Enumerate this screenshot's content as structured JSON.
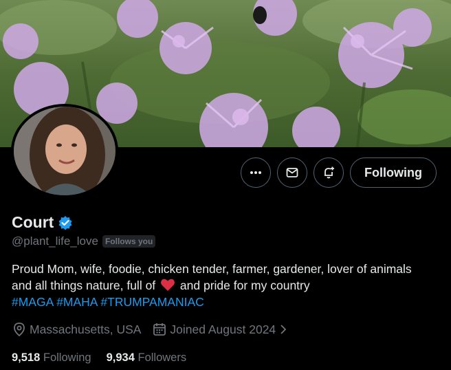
{
  "profile": {
    "name": "Court",
    "handle": "@plant_life_love",
    "follows_you": "Follows you",
    "bio_line": "Proud Mom, wife, foodie, chicken tender, farmer, gardener, lover of animals and all things nature, full of",
    "bio_tail": "and pride for my country",
    "hashtags": [
      "#MAGA",
      "#MAHA",
      "#TRUMPAMANIAC"
    ],
    "location": "Massachusetts, USA",
    "joined": "Joined August 2024",
    "following_count": "9,518",
    "following_label": "Following",
    "followers_count": "9,934",
    "followers_label": "Followers"
  },
  "actions": {
    "follow_label": "Following",
    "icons": [
      "more-icon",
      "message-icon",
      "notification-icon"
    ]
  },
  "colors": {
    "accent": "#1d9bf0",
    "muted": "#71767b",
    "background": "#000000",
    "verified": "#1d9bf0",
    "heart": "#e0245e"
  }
}
